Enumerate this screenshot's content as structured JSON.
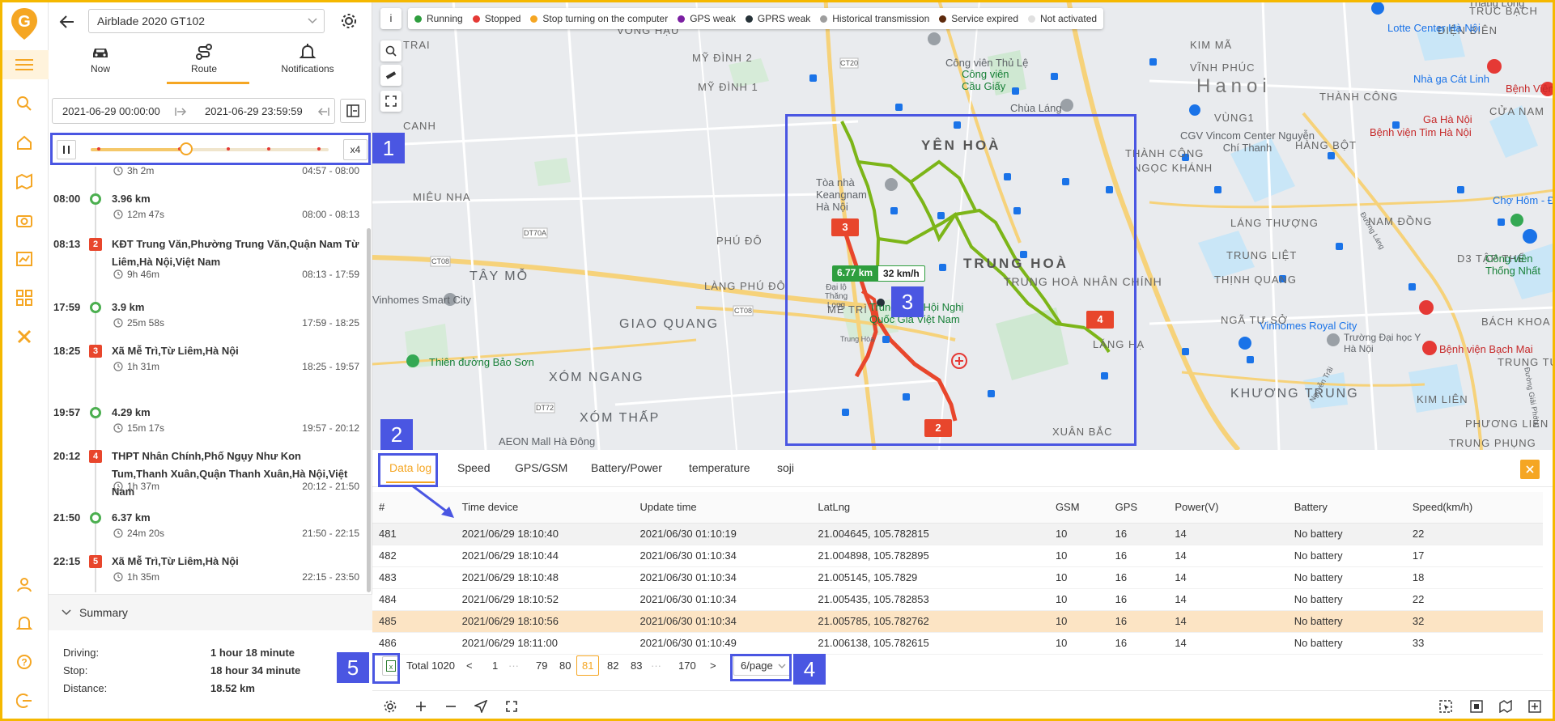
{
  "header": {
    "device": "Airblade 2020 GT102",
    "tabs": [
      {
        "label": "Now"
      },
      {
        "label": "Route"
      },
      {
        "label": "Notifications"
      }
    ],
    "start_time": "2021-06-29 00:00:00",
    "end_time": "2021-06-29 23:59:59"
  },
  "player": {
    "speed": "x4",
    "progress": 0.4
  },
  "timeline": [
    {
      "type": "stop_tail",
      "duration": "3h 2m",
      "range": "04:57 - 08:00"
    },
    {
      "type": "run",
      "time": "08:00",
      "title": "3.96 km",
      "duration": "12m 47s",
      "range": "08:00 - 08:13"
    },
    {
      "type": "stop",
      "num": "2",
      "time": "08:13",
      "title": "KĐT Trung Văn,Phường Trung Văn,Quận Nam Từ Liêm,Hà Nội,Việt Nam",
      "duration": "9h 46m",
      "range": "08:13 - 17:59"
    },
    {
      "type": "run",
      "time": "17:59",
      "title": "3.9 km",
      "duration": "25m 58s",
      "range": "17:59 - 18:25"
    },
    {
      "type": "stop",
      "num": "3",
      "time": "18:25",
      "title": "Xã Mễ Trì,Từ Liêm,Hà Nội",
      "duration": "1h 31m",
      "range": "18:25 - 19:57"
    },
    {
      "type": "run",
      "time": "19:57",
      "title": "4.29 km",
      "duration": "15m 17s",
      "range": "19:57 - 20:12"
    },
    {
      "type": "stop",
      "num": "4",
      "time": "20:12",
      "title": "THPT Nhân Chính,Phố Ngụy Như Kon Tum,Thanh Xuân,Quận Thanh Xuân,Hà Nội,Việt Nam",
      "duration": "1h 37m",
      "range": "20:12 - 21:50"
    },
    {
      "type": "run",
      "time": "21:50",
      "title": "6.37 km",
      "duration": "24m 20s",
      "range": "21:50 - 22:15"
    },
    {
      "type": "stop",
      "num": "5",
      "time": "22:15",
      "title": "Xã Mễ Trì,Từ Liêm,Hà Nội",
      "duration": "1h 35m",
      "range": "22:15 - 23:50"
    }
  ],
  "summary": {
    "title": "Summary",
    "rows": [
      {
        "label": "Driving:",
        "value": "1 hour 18 minute"
      },
      {
        "label": "Stop:",
        "value": "18 hour 34 minute"
      },
      {
        "label": "Distance:",
        "value": "18.52 km"
      }
    ]
  },
  "map": {
    "info": "i",
    "legend": [
      {
        "label": "Running",
        "color": "#2e9e3e"
      },
      {
        "label": "Stopped",
        "color": "#e53935"
      },
      {
        "label": "Stop turning on the computer",
        "color": "#f5a623"
      },
      {
        "label": "GPS weak",
        "color": "#7b1fa2"
      },
      {
        "label": "GPRS weak",
        "color": "#263238"
      },
      {
        "label": "Historical transmission",
        "color": "#9e9e9e"
      },
      {
        "label": "Service expired",
        "color": "#5d2a0c"
      },
      {
        "label": "Not activated",
        "color": "#e0e0e0"
      }
    ],
    "districts": [
      "TRAI",
      "VONG HẬU",
      "CANH",
      "MỸ ĐÌNH 2",
      "MỸ ĐÌNH 1",
      "YÊN HOÀ",
      "MIÊU NHA",
      "PHÚ ĐÔ",
      "LÀNG PHÚ ĐÔ",
      "TRUNG HOÀ",
      "TRUNG HOÀ NHÂN CHÍNH",
      "MỄ TRÌ",
      "GIAO QUANG",
      "XÓM NGANG",
      "XÓM THẤP",
      "THÀNH CÔNG",
      "LÁNG HẠ",
      "KIM MÃ",
      "VĨNH PHÚC",
      "NGỌC KHÁNH",
      "VÙNG1",
      "HÀNG BỘT",
      "NAM ĐỒNG",
      "LÁNG THƯỢNG",
      "TRUNG LIỆT",
      "THỊNH QUANG",
      "NGÃ TƯ SỞ",
      "KHƯƠNG TRUNG",
      "KIM LIÊN",
      "PHƯƠNG LIÊN",
      "TRUNG PHỤNG",
      "ĐIỆN BIÊN",
      "THÀNH CÔNG",
      "CỬA NAM",
      "D3 TẬP THỂ",
      "BÁCH KHOA",
      "TRUNG TỰ",
      "XUÂN BẮC",
      "TÂY MỖ",
      "TRÚC BẠCH"
    ],
    "city": "Hanoi",
    "pois": [
      {
        "label": "Lotte Center Hà Nội",
        "kind": "blue"
      },
      {
        "label": "Công viên Thủ Lệ",
        "kind": "gray"
      },
      {
        "label": "Công viên Cầu Giấy",
        "kind": "green"
      },
      {
        "label": "Chùa Láng",
        "kind": "gray"
      },
      {
        "label": "CGV Vincom Center Nguyễn Chí Thanh",
        "kind": "gray"
      },
      {
        "label": "Nhà ga Cát Linh",
        "kind": "blue"
      },
      {
        "label": "Ga Hà Nội",
        "kind": "blue"
      },
      {
        "label": "Bệnh Viện Việt Đức",
        "kind": "red"
      },
      {
        "label": "Bệnh viện Tim Hà Nội",
        "kind": "red"
      },
      {
        "label": "Tòa nhà Keangnam Hà Nội",
        "kind": "gray"
      },
      {
        "label": "Trung Tâm Hội Nghị Quốc Gia Việt Nam",
        "kind": "green"
      },
      {
        "label": "Vinhomes Smart City",
        "kind": "gray"
      },
      {
        "label": "Thiên đường Bảo Sơn",
        "kind": "green"
      },
      {
        "label": "AEON Mall Hà Đông",
        "kind": "gray"
      },
      {
        "label": "Vinhomes Royal City",
        "kind": "blue"
      },
      {
        "label": "Trường Đại học Y Hà Nội",
        "kind": "gray"
      },
      {
        "label": "Bệnh viện Bạch Mai",
        "kind": "red"
      },
      {
        "label": "Chợ Hôm - Đức Viên",
        "kind": "blue"
      },
      {
        "label": "Công viên Thống Nhất",
        "kind": "green"
      },
      {
        "label": "Tháng Long",
        "kind": "gray"
      }
    ],
    "roads": [
      "CT20",
      "DT70A",
      "CT08",
      "CT08",
      "Đại lộ Thăng Long",
      "DT72",
      "Trung Hòa",
      "Nguyễn Trãi",
      "Đường Láng",
      "Đường Giải Phóng"
    ],
    "trip_distance": "6.77 km",
    "trip_speed": "32 km/h",
    "stop_pins": [
      "2",
      "4",
      "3"
    ]
  },
  "annotations": [
    "1",
    "2",
    "3",
    "4",
    "5"
  ],
  "data_tabs": [
    {
      "label": "Data log",
      "active": true
    },
    {
      "label": "Speed"
    },
    {
      "label": "GPS/GSM"
    },
    {
      "label": "Battery/Power"
    },
    {
      "label": "temperature"
    },
    {
      "label": "soji"
    }
  ],
  "table": {
    "columns": [
      "#",
      "Time device",
      "Update time",
      "LatLng",
      "GSM",
      "GPS",
      "Power(V)",
      "Battery",
      "Speed(km/h)"
    ],
    "rows": [
      [
        "481",
        "2021/06/29 18:10:40",
        "2021/06/30 01:10:19",
        "21.004645, 105.782815",
        "10",
        "16",
        "14",
        "No battery",
        "22"
      ],
      [
        "482",
        "2021/06/29 18:10:44",
        "2021/06/30 01:10:34",
        "21.004898, 105.782895",
        "10",
        "16",
        "14",
        "No battery",
        "17"
      ],
      [
        "483",
        "2021/06/29 18:10:48",
        "2021/06/30 01:10:34",
        "21.005145, 105.7829",
        "10",
        "16",
        "14",
        "No battery",
        "18"
      ],
      [
        "484",
        "2021/06/29 18:10:52",
        "2021/06/30 01:10:34",
        "21.005435, 105.782853",
        "10",
        "16",
        "14",
        "No battery",
        "22"
      ],
      [
        "485",
        "2021/06/29 18:10:56",
        "2021/06/30 01:10:34",
        "21.005785, 105.782762",
        "10",
        "16",
        "14",
        "No battery",
        "32"
      ],
      [
        "486",
        "2021/06/29 18:11:00",
        "2021/06/30 01:10:49",
        "21.006138, 105.782615",
        "10",
        "16",
        "14",
        "No battery",
        "33"
      ]
    ],
    "highlight_row": 4
  },
  "pagination": {
    "total": "Total 1020",
    "prev": "<",
    "next": ">",
    "pages": [
      "1",
      "···",
      "79",
      "80",
      "81",
      "82",
      "83",
      "···",
      "170"
    ],
    "current": "81",
    "page_size": "6/page"
  }
}
